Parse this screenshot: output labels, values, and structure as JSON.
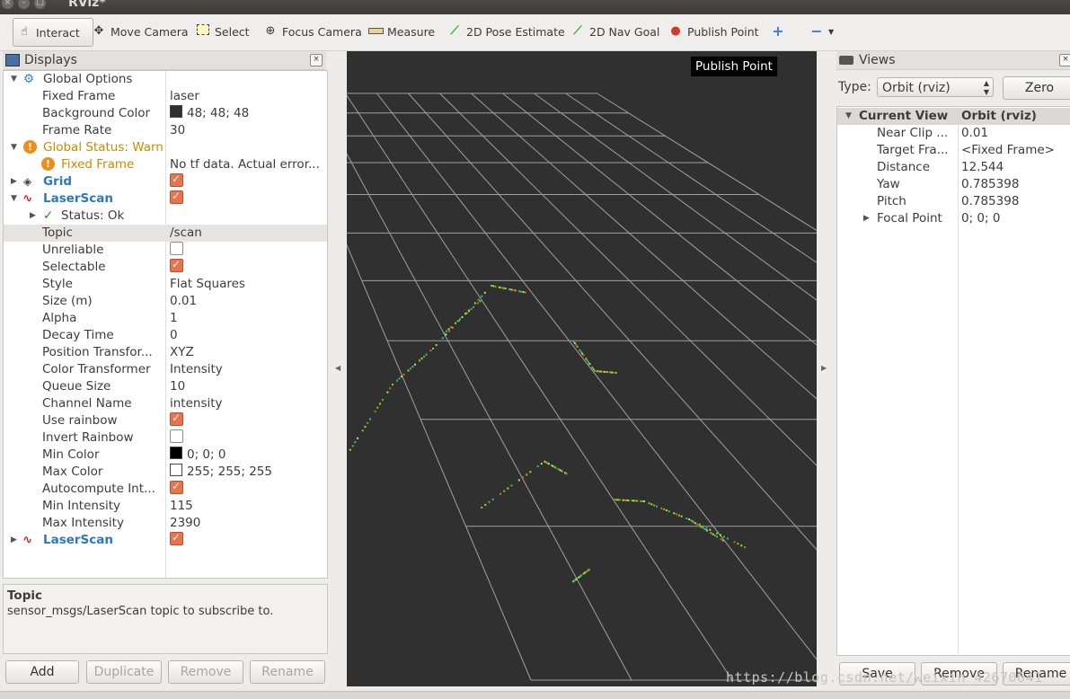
{
  "window": {
    "title": "RViz*"
  },
  "toolbar": {
    "tools": [
      {
        "label": "Interact",
        "icon": "hand-icon"
      },
      {
        "label": "Move Camera",
        "icon": "move-camera-icon"
      },
      {
        "label": "Select",
        "icon": "select-icon"
      },
      {
        "label": "Focus Camera",
        "icon": "focus-camera-icon"
      },
      {
        "label": "Measure",
        "icon": "ruler-icon"
      },
      {
        "label": "2D Pose Estimate",
        "icon": "pose-arrow-icon"
      },
      {
        "label": "2D Nav Goal",
        "icon": "nav-arrow-icon"
      },
      {
        "label": "Publish Point",
        "icon": "pin-icon"
      }
    ],
    "active_tool": "Interact",
    "tooltip": "Publish Point"
  },
  "displays": {
    "title": "Displays",
    "global_options": {
      "label": "Global Options",
      "fixed_frame_label": "Fixed Frame",
      "fixed_frame": "laser",
      "background_color_label": "Background Color",
      "background_color": "48; 48; 48",
      "background_swatch": "#303030",
      "frame_rate_label": "Frame Rate",
      "frame_rate": "30"
    },
    "global_status": {
      "label": "Global Status: Warn",
      "fixed_frame_label": "Fixed Frame",
      "fixed_frame_msg": "No tf data.  Actual error...",
      "warn_color": "#c88a05"
    },
    "grid": {
      "label": "Grid",
      "enabled": true
    },
    "laserscan": {
      "label": "LaserScan",
      "status": "Status: Ok",
      "props": [
        {
          "name": "Topic",
          "value": "/scan",
          "selected": true
        },
        {
          "name": "Unreliable",
          "check": false
        },
        {
          "name": "Selectable",
          "check": true
        },
        {
          "name": "Style",
          "value": "Flat Squares"
        },
        {
          "name": "Size (m)",
          "value": "0.01"
        },
        {
          "name": "Alpha",
          "value": "1"
        },
        {
          "name": "Decay Time",
          "value": "0"
        },
        {
          "name": "Position Transfor...",
          "value": "XYZ"
        },
        {
          "name": "Color Transformer",
          "value": "Intensity"
        },
        {
          "name": "Queue Size",
          "value": "10"
        },
        {
          "name": "Channel Name",
          "value": "intensity"
        },
        {
          "name": "Use rainbow",
          "check": true
        },
        {
          "name": "Invert Rainbow",
          "check": false
        },
        {
          "name": "Min Color",
          "value": "0; 0; 0",
          "swatch": "#000000"
        },
        {
          "name": "Max Color",
          "value": "255; 255; 255",
          "swatch": "#ffffff"
        },
        {
          "name": "Autocompute Int...",
          "check": true
        },
        {
          "name": "Min Intensity",
          "value": "115"
        },
        {
          "name": "Max Intensity",
          "value": "2390"
        }
      ]
    },
    "laserscan2": {
      "label": "LaserScan",
      "enabled": true
    },
    "description": {
      "title": "Topic",
      "text": "sensor_msgs/LaserScan topic to subscribe to."
    },
    "buttons": {
      "add": "Add",
      "duplicate": "Duplicate",
      "remove": "Remove",
      "rename": "Rename"
    }
  },
  "views": {
    "title": "Views",
    "type_label": "Type:",
    "type_value": "Orbit (rviz)",
    "zero_button": "Zero",
    "current_view": {
      "label": "Current View",
      "value": "Orbit (rviz)",
      "props": [
        {
          "name": "Near Clip ...",
          "value": "0.01"
        },
        {
          "name": "Target Fra...",
          "value": "<Fixed Frame>"
        },
        {
          "name": "Distance",
          "value": "12.544"
        },
        {
          "name": "Yaw",
          "value": "0.785398"
        },
        {
          "name": "Pitch",
          "value": "0.785398"
        },
        {
          "name": "Focal Point",
          "value": "0; 0; 0"
        }
      ]
    },
    "buttons": {
      "save": "Save",
      "remove": "Remove",
      "rename": "Rename"
    }
  },
  "watermark": "https://blog.csdn.net/weixin_42670641"
}
